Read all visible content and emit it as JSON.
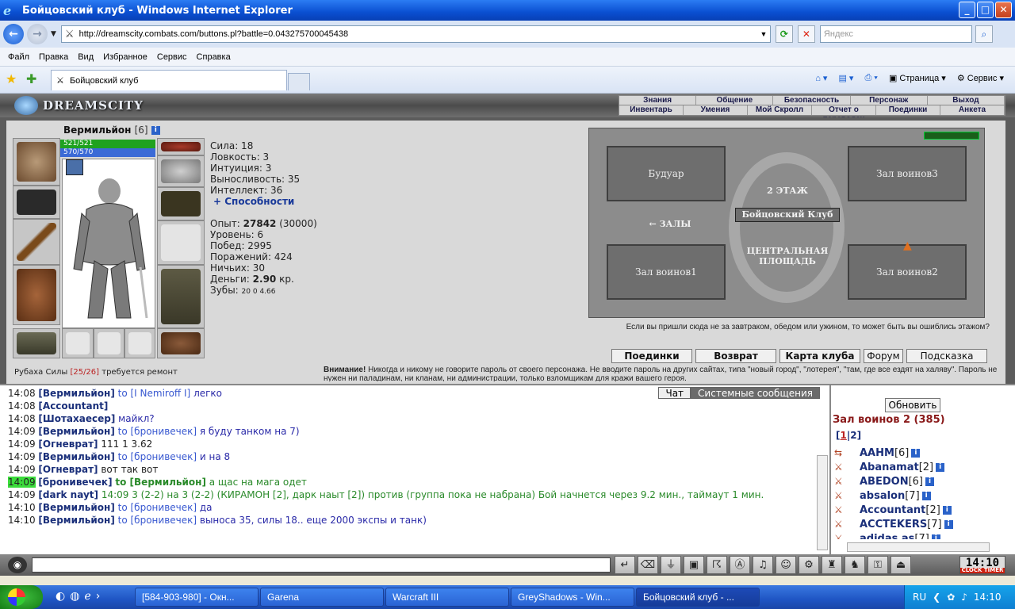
{
  "window": {
    "title": "Бойцовский клуб - Windows Internet Explorer",
    "url": "http://dreamscity.combats.com/buttons.pl?battle=0.043275700045438",
    "search_placeholder": "Яндекс",
    "menu": [
      "Файл",
      "Правка",
      "Вид",
      "Избранное",
      "Сервис",
      "Справка"
    ],
    "tab_title": "Бойцовский клуб",
    "cmd": {
      "page": "Страница",
      "service": "Сервис"
    }
  },
  "game": {
    "logo": "DREAMSCITY",
    "top_nav": [
      "Знания",
      "Общение",
      "Безопасность",
      "Персонаж",
      "Выход"
    ],
    "sub_nav": [
      "Инвентарь",
      "Умения",
      "Мой Скролл",
      "Отчет о переводах",
      "Поединки",
      "Анкета"
    ],
    "character": {
      "name": "Вермильйон",
      "level": "[6]",
      "hp": "521/521",
      "mp": "570/570",
      "item_note_name": "Рубаха Силы",
      "item_note_dur": "[25/26]",
      "item_note_text": "требуется ремонт"
    },
    "stats": {
      "str": "Сила: 18",
      "dex": "Ловкость: 3",
      "int": "Интуиция: 3",
      "end": "Выносливость: 35",
      "intel": "Интеллект: 36",
      "abilities": "+ Способности",
      "exp_label": "Опыт:",
      "exp_value": "27842",
      "exp_next": "(30000)",
      "level_text": "Уровень: 6",
      "wins": "Побед: 2995",
      "losses": "Поражений: 424",
      "draws": "Ничьих: 30",
      "money_label": "Деньги:",
      "money_value": "2.90",
      "money_unit": "кр.",
      "teeth_label": "Зубы:",
      "teeth_values": "20  0  4.66"
    },
    "map": {
      "rooms": [
        "Будуар",
        "Зал воинов3",
        "Зал воинов1",
        "Зал воинов2"
      ],
      "floor": "2 ЭТАЖ",
      "club": "Бойцовский Клуб",
      "halls": "← ЗАЛЫ",
      "center": "ЦЕНТРАЛЬНАЯ ПЛОЩАДЬ",
      "caption": "Если вы пришли сюда не за завтраком, обедом или ужином, то может быть вы ошиблись этажом?"
    },
    "actions": [
      "Поединки",
      "Возврат",
      "Карта клуба",
      "Форум",
      "Подсказка"
    ],
    "warning_label": "Внимание!",
    "warning_text": "Никогда и никому не говорите пароль от своего персонажа. Не вводите пароль на других сайтах, типа \"новый город\", \"лотерея\", \"там, где все ездят на халяву\". Пароль не нужен ни паладинам, ни кланам, ни администрации, только взломщикам для кражи вашего героя."
  },
  "chat": {
    "tabs": [
      "Чат",
      "Системные сообщения"
    ],
    "lines": [
      {
        "time": "14:08",
        "nick": "[Вермильйон]",
        "to": "to [I Nemiroff I]",
        "msg": "легко"
      },
      {
        "time": "14:08",
        "nick": "[Accountant]",
        "to": "",
        "msg": ""
      },
      {
        "time": "14:08",
        "nick": "[Шотахаесер]",
        "to": "",
        "msg": "майкл?"
      },
      {
        "time": "14:09",
        "nick": "[Вермильйон]",
        "to": "to [бронивечек]",
        "msg": "я буду танком на 7)"
      },
      {
        "time": "14:09",
        "nick": "[Огневрат]",
        "to": "",
        "msg": "111 1 3.62"
      },
      {
        "time": "14:09",
        "nick": "[Вермильйон]",
        "to": "to [бронивечек]",
        "msg": "и на 8"
      },
      {
        "time": "14:09",
        "nick": "[Огневрат]",
        "to": "",
        "msg": "вот так вот"
      },
      {
        "time": "14:09",
        "nick": "[бронивечек]",
        "to": "to [Вермильйон]",
        "msg": "а щас на мага одет"
      },
      {
        "time": "14:09",
        "nick": "[dark nayt]",
        "to": "",
        "msg": "14:09 3 (2-2) на 3 (2-2) (КИРАМОН [2], дарк наыт [2]) против (группа пока не набрана) Бой начнется через 9.2 мин., таймаут 1 мин."
      },
      {
        "time": "14:10",
        "nick": "[Вермильйон]",
        "to": "to [бронивечек]",
        "msg": "да"
      },
      {
        "time": "14:10",
        "nick": "[Вермильйон]",
        "to": "to [бронивечек]",
        "msg": "выноса 35, силы 18.. еще 2000 экспы и танк)"
      }
    ]
  },
  "room": {
    "refresh": "Обновить",
    "title": "Зал воинов 2 (385)",
    "pages": [
      "1",
      "2"
    ],
    "players": [
      {
        "name": "AAHM",
        "level": "[6]"
      },
      {
        "name": "Abanamat",
        "level": "[2]"
      },
      {
        "name": "ABEDON",
        "level": "[6]"
      },
      {
        "name": "absalon",
        "level": "[7]"
      },
      {
        "name": "Accountant",
        "level": "[2]"
      },
      {
        "name": "ACCTEKERS",
        "level": "[7]"
      },
      {
        "name": "adidas as",
        "level": "[7]"
      }
    ]
  },
  "toolbar": {
    "clock": "14:10",
    "clock_label": "CLOCK TIMER"
  },
  "taskbar": {
    "buttons": [
      "[584-903-980] - Окн...",
      "Garena",
      "Warcraft III",
      "GreyShadows - Win...",
      "Бойцовский клуб - ..."
    ],
    "lang": "RU",
    "time": "14:10"
  }
}
